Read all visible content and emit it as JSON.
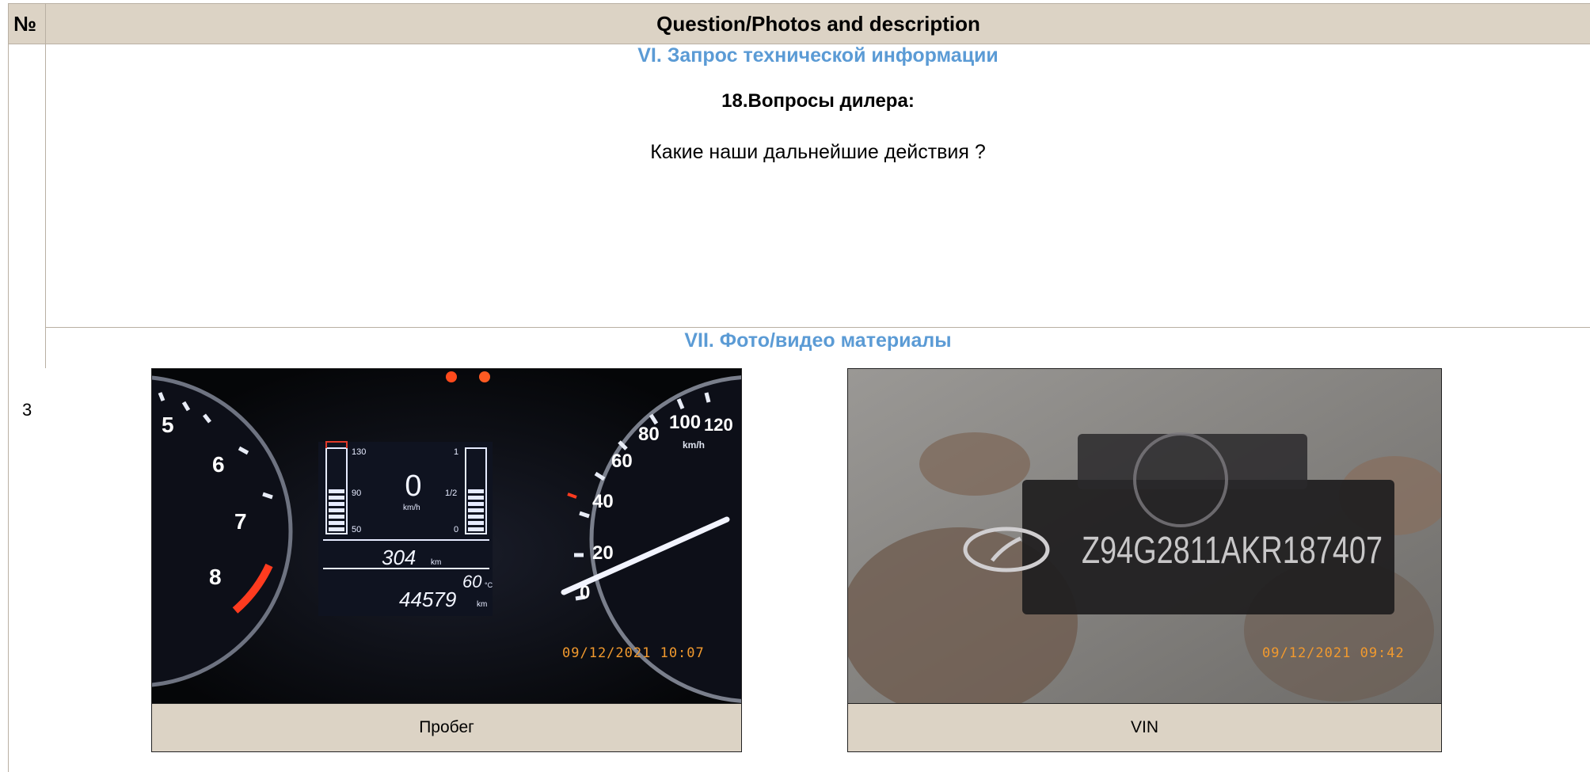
{
  "table": {
    "header_number": "№",
    "header_title": "Question/Photos and description",
    "row_number": "3"
  },
  "section6": {
    "title": "VI. Запрос технической информации",
    "question_title": "18.Вопросы дилера:",
    "question_text": "Какие наши дальнейшие действия ?"
  },
  "section7": {
    "title": "VII. Фото/видео материалы",
    "photos": [
      {
        "caption": "Пробег",
        "timestamp": "09/12/2021 10:07",
        "dash": {
          "tacho_ticks": [
            "5",
            "6",
            "7",
            "8"
          ],
          "speedo_ticks": [
            "0",
            "20",
            "40",
            "60",
            "80",
            "100",
            "120"
          ],
          "speed_unit": "km/h",
          "temp_high": "130",
          "temp_mid": "90",
          "temp_low": "50",
          "fuel_full": "1",
          "fuel_half": "1/2",
          "fuel_empty": "0",
          "speed_value": "0",
          "trip": "304",
          "trip_unit": "km",
          "outside_temp": "60",
          "temp_unit": "°C",
          "odometer": "44579",
          "odo_unit": "km"
        }
      },
      {
        "caption": "VIN",
        "timestamp": "09/12/2021 09:42",
        "vin": "Z94G2811AKR187407"
      }
    ]
  }
}
